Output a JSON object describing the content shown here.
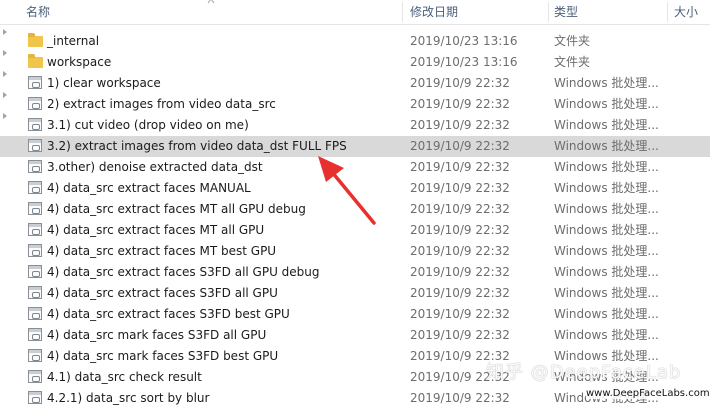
{
  "header": {
    "col_name": "名称",
    "col_date": "修改日期",
    "col_type": "类型",
    "col_size": "大小"
  },
  "rows": [
    {
      "icon": "folder-icon",
      "name": "_internal",
      "date": "2019/10/23 13:16",
      "type": "文件夹"
    },
    {
      "icon": "folder-icon",
      "name": "workspace",
      "date": "2019/10/23 13:16",
      "type": "文件夹"
    },
    {
      "icon": "batch-file-icon",
      "name": "1) clear workspace",
      "date": "2019/10/9 22:32",
      "type": "Windows 批处理..."
    },
    {
      "icon": "batch-file-icon",
      "name": "2) extract images from video data_src",
      "date": "2019/10/9 22:32",
      "type": "Windows 批处理..."
    },
    {
      "icon": "batch-file-icon",
      "name": "3.1) cut video (drop video on me)",
      "date": "2019/10/9 22:32",
      "type": "Windows 批处理..."
    },
    {
      "icon": "batch-file-icon",
      "name": "3.2) extract images from video data_dst FULL FPS",
      "date": "2019/10/9 22:32",
      "type": "Windows 批处理..."
    },
    {
      "icon": "batch-file-icon",
      "name": "3.other) denoise extracted data_dst",
      "date": "2019/10/9 22:32",
      "type": "Windows 批处理..."
    },
    {
      "icon": "batch-file-icon",
      "name": "4) data_src extract faces MANUAL",
      "date": "2019/10/9 22:32",
      "type": "Windows 批处理..."
    },
    {
      "icon": "batch-file-icon",
      "name": "4) data_src extract faces MT all GPU debug",
      "date": "2019/10/9 22:32",
      "type": "Windows 批处理..."
    },
    {
      "icon": "batch-file-icon",
      "name": "4) data_src extract faces MT all GPU",
      "date": "2019/10/9 22:32",
      "type": "Windows 批处理..."
    },
    {
      "icon": "batch-file-icon",
      "name": "4) data_src extract faces MT best GPU",
      "date": "2019/10/9 22:32",
      "type": "Windows 批处理..."
    },
    {
      "icon": "batch-file-icon",
      "name": "4) data_src extract faces S3FD all GPU debug",
      "date": "2019/10/9 22:32",
      "type": "Windows 批处理..."
    },
    {
      "icon": "batch-file-icon",
      "name": "4) data_src extract faces S3FD all GPU",
      "date": "2019/10/9 22:32",
      "type": "Windows 批处理..."
    },
    {
      "icon": "batch-file-icon",
      "name": "4) data_src extract faces S3FD best GPU",
      "date": "2019/10/9 22:32",
      "type": "Windows 批处理..."
    },
    {
      "icon": "batch-file-icon",
      "name": "4) data_src mark faces S3FD all GPU",
      "date": "2019/10/9 22:32",
      "type": "Windows 批处理..."
    },
    {
      "icon": "batch-file-icon",
      "name": "4) data_src mark faces S3FD best GPU",
      "date": "2019/10/9 22:32",
      "type": "Windows 批处理..."
    },
    {
      "icon": "batch-file-icon",
      "name": "4.1) data_src check result",
      "date": "2019/10/9 22:32",
      "type": "Windows 批处理..."
    },
    {
      "icon": "batch-file-icon",
      "name": "4.2.1) data_src sort by blur",
      "date": "2019/10/9 22:32",
      "type": "Windows 批处理..."
    }
  ],
  "selected_row": "3.2) extract images from video data_dst FULL FPS",
  "watermark": {
    "main": "知乎 @DeepFaceLab",
    "url": "www.DeepFaceLabs.com"
  },
  "colors": {
    "selected_row_bg": "#d9d9d9",
    "arrow": "#e8312e",
    "folder": "#f1c44a",
    "header_text": "#4c607a"
  }
}
